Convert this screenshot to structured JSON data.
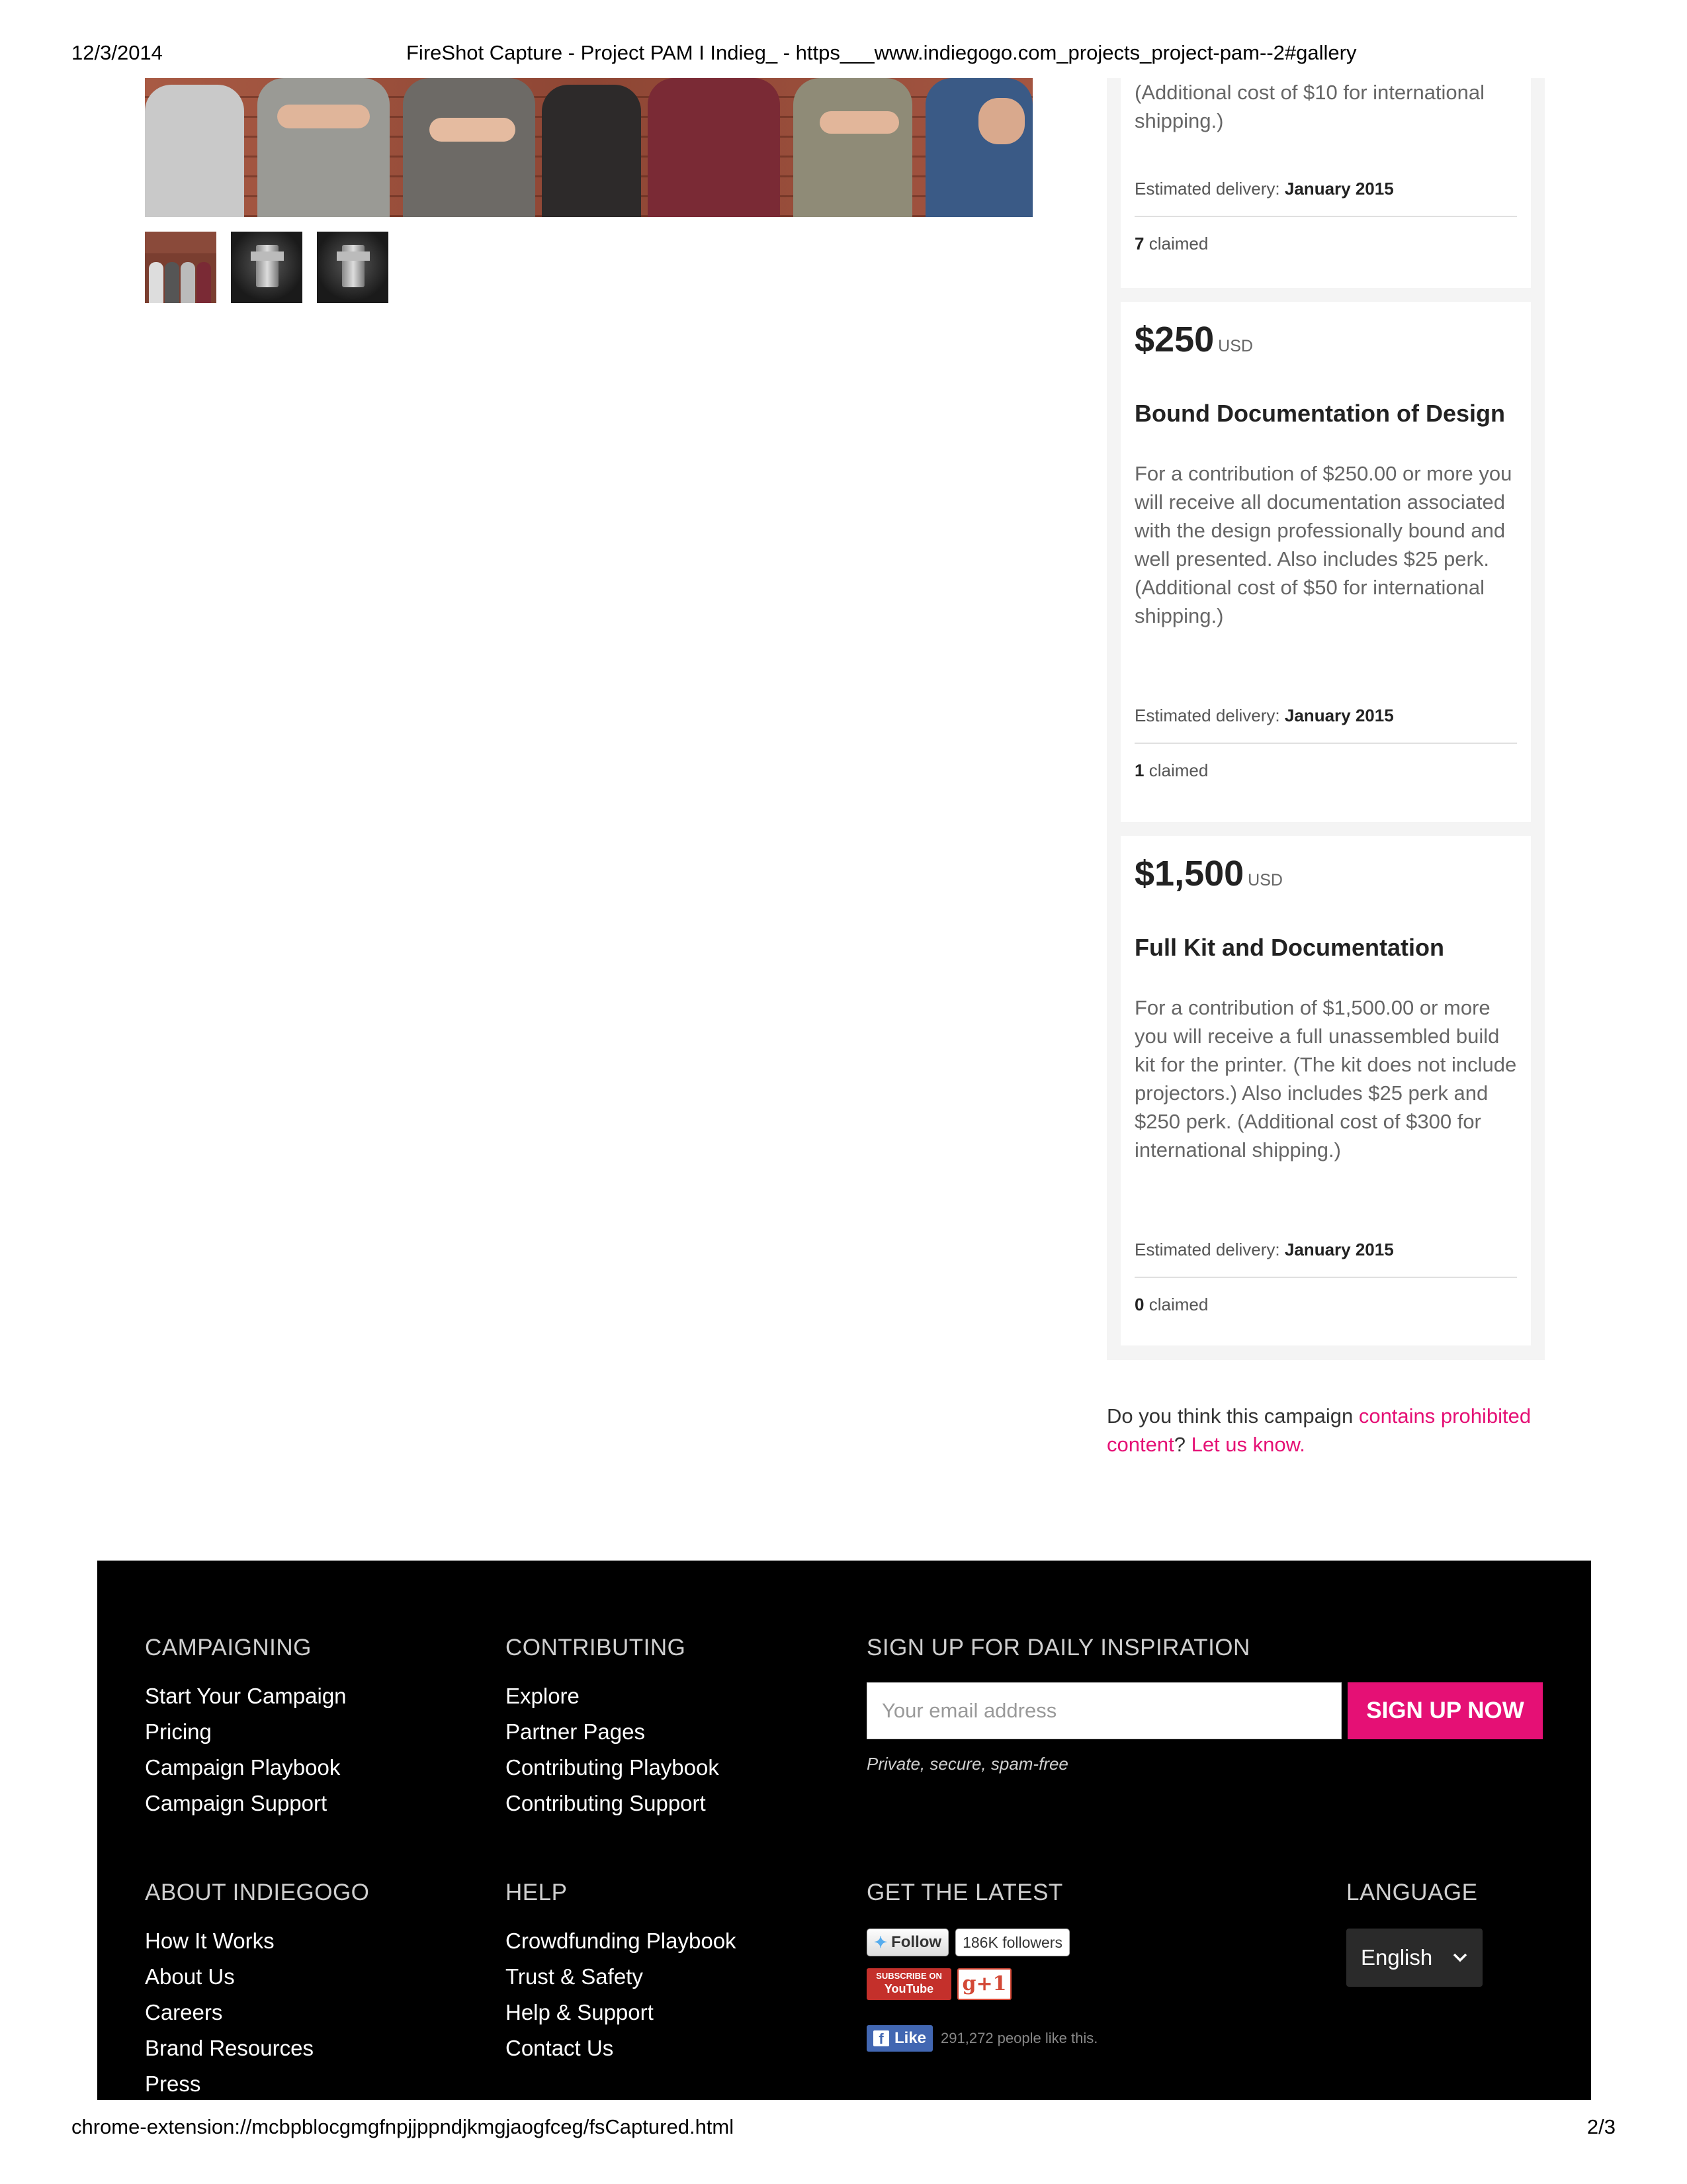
{
  "print_header": {
    "date": "12/3/2014",
    "title": "FireShot Capture - Project PAM I Indieg_ - https___www.indiegogo.com_projects_project-pam--2#gallery"
  },
  "print_footer": {
    "url": "chrome-extension://mcbpblocgmgfnpjjppndjkmgjaogfceg/fsCaptured.html",
    "page": "2/3"
  },
  "perks": [
    {
      "desc": "(Additional cost of $10 for international shipping.)",
      "est_label": "Estimated delivery:",
      "est_value": "January 2015",
      "claimed_count": "7",
      "claimed_label": "claimed"
    },
    {
      "amount": "$250",
      "currency": "USD",
      "title": "Bound Documentation of Design",
      "desc": "For a contribution of $250.00 or more you will receive all documentation associated with the design professionally bound and well presented. Also includes $25 perk. (Additional cost of $50 for international shipping.)",
      "est_label": "Estimated delivery:",
      "est_value": "January 2015",
      "claimed_count": "1",
      "claimed_label": "claimed"
    },
    {
      "amount": "$1,500",
      "currency": "USD",
      "title": "Full Kit and Documentation",
      "desc": "For a contribution of $1,500.00 or more you will receive a full unassembled build kit for the printer. (The kit does not include projectors.) Also includes $25 perk and $250 perk. (Additional cost of $300 for international shipping.)",
      "est_label": "Estimated delivery:",
      "est_value": "January 2015",
      "claimed_count": "0",
      "claimed_label": "claimed"
    }
  ],
  "report": {
    "prefix": "Do you think this campaign",
    "link1": "contains prohibited content",
    "mid": "?",
    "link2": "Let us know."
  },
  "footer": {
    "campaigning": {
      "heading": "CAMPAIGNING",
      "links": [
        "Start Your Campaign",
        "Pricing",
        "Campaign Playbook",
        "Campaign Support"
      ]
    },
    "contributing": {
      "heading": "CONTRIBUTING",
      "links": [
        "Explore",
        "Partner Pages",
        "Contributing Playbook",
        "Contributing Support"
      ]
    },
    "signup": {
      "heading": "SIGN UP FOR DAILY INSPIRATION",
      "placeholder": "Your email address",
      "button": "SIGN UP NOW",
      "note": "Private, secure, spam-free"
    },
    "about": {
      "heading": "ABOUT INDIEGOGO",
      "links": [
        "How It Works",
        "About Us",
        "Careers",
        "Brand Resources",
        "Press"
      ]
    },
    "help": {
      "heading": "HELP",
      "links": [
        "Crowdfunding Playbook",
        "Trust & Safety",
        "Help & Support",
        "Contact Us"
      ]
    },
    "latest": {
      "heading": "GET THE LATEST",
      "twitter_follow": "Follow",
      "twitter_count": "186K followers",
      "youtube_line1": "SUBSCRIBE ON",
      "youtube_line2": "YouTube",
      "gplus": "g+1",
      "fb_like": "Like",
      "fb_text": "291,272 people like this."
    },
    "language": {
      "heading": "LANGUAGE",
      "selected": "English"
    }
  },
  "colors": {
    "accent": "#e51075",
    "footer_bg": "#000000",
    "perk_panel_bg": "#f4f4f4"
  }
}
